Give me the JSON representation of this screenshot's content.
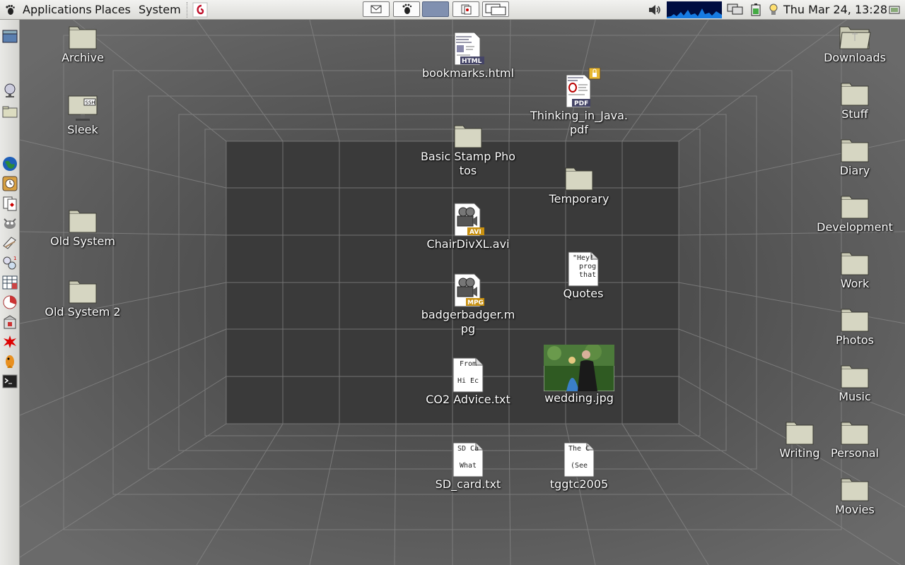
{
  "top_panel": {
    "menus": [
      "Applications",
      "Places",
      "System"
    ],
    "clock": "Thu Mar 24, 13:28"
  },
  "desktop": {
    "left_column": [
      {
        "name": "Archive",
        "type": "folder"
      },
      {
        "name": "Sleek",
        "type": "ssh-folder",
        "badge": "SSH"
      },
      {
        "name": "Old System",
        "type": "folder"
      },
      {
        "name": "Old System 2",
        "type": "folder"
      }
    ],
    "center_column": [
      {
        "name": "bookmarks.html",
        "type": "html",
        "badge": "HTML"
      },
      {
        "name": "Basic Stamp Photos",
        "type": "folder"
      },
      {
        "name": "ChairDivXL.avi",
        "type": "video",
        "badge": "AVI"
      },
      {
        "name": "badgerbadger.mpg",
        "type": "video",
        "badge": "MPG"
      },
      {
        "name": "CO2 Advice.txt",
        "type": "text",
        "preview": "From\n\nHi Ec"
      },
      {
        "name": "SD_card.txt",
        "type": "text",
        "preview": "SD Ca\n\nWhat"
      }
    ],
    "second_column": [
      {
        "name": "Thinking_in_Java.pdf",
        "type": "pdf",
        "badge": "PDF"
      },
      {
        "name": "Temporary",
        "type": "folder"
      },
      {
        "name": "Quotes",
        "type": "text",
        "preview": "\"Hey!\n  prog\n  that"
      },
      {
        "name": "wedding.jpg",
        "type": "image"
      },
      {
        "name": "tggtc2005",
        "type": "text",
        "preview": "The C\n\n(See"
      }
    ],
    "right_column": [
      {
        "name": "Downloads",
        "type": "folder"
      },
      {
        "name": "Stuff",
        "type": "folder"
      },
      {
        "name": "Diary",
        "type": "folder"
      },
      {
        "name": "Development",
        "type": "folder"
      },
      {
        "name": "Work",
        "type": "folder"
      },
      {
        "name": "Photos",
        "type": "folder"
      },
      {
        "name": "Music",
        "type": "folder"
      },
      {
        "name": "Personal",
        "type": "folder"
      },
      {
        "name": "Movies",
        "type": "folder"
      }
    ],
    "extra": [
      {
        "name": "Writing",
        "type": "folder"
      }
    ]
  }
}
